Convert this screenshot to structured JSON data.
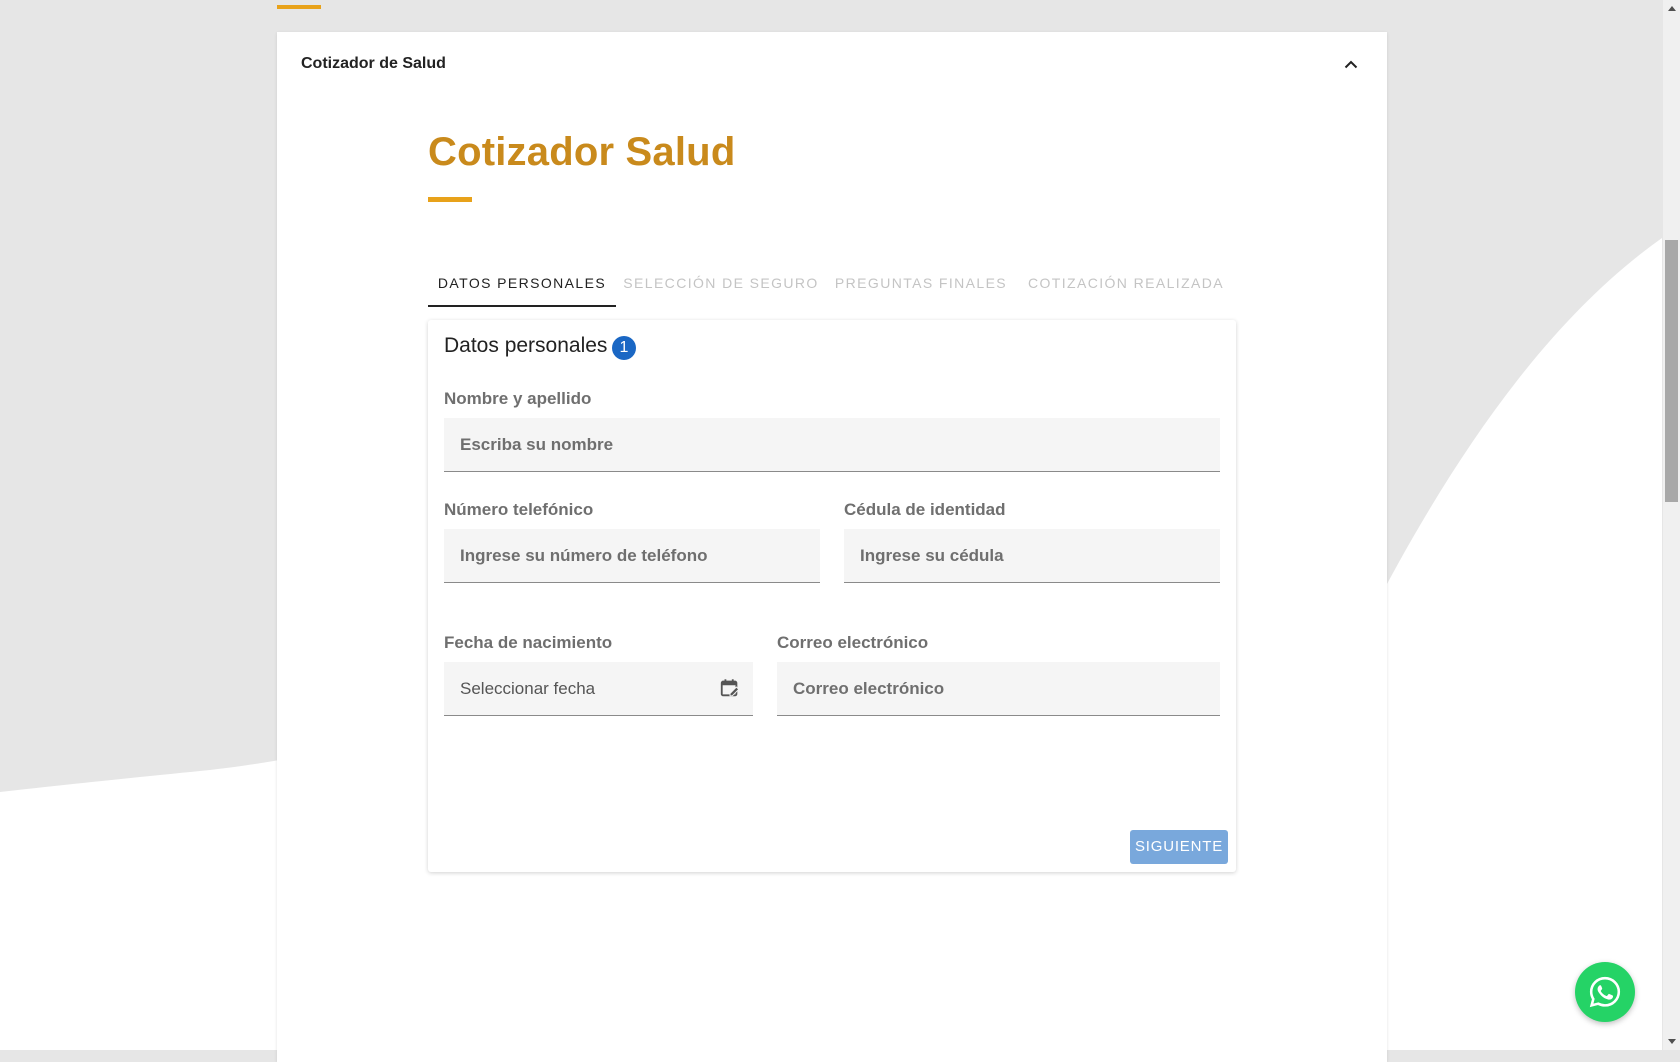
{
  "panel": {
    "header_title": "Cotizador de Salud"
  },
  "main": {
    "title": "Cotizador Salud"
  },
  "tabs": [
    {
      "label": "DATOS PERSONALES",
      "active": true
    },
    {
      "label": "SELECCIÓN DE SEGURO",
      "active": false
    },
    {
      "label": "PREGUNTAS FINALES",
      "active": false
    },
    {
      "label": "COTIZACIÓN REALIZADA",
      "active": false
    }
  ],
  "form": {
    "section_title": "Datos personales",
    "step_number": "1",
    "name": {
      "label": "Nombre y apellido",
      "placeholder": "Escriba su nombre",
      "value": ""
    },
    "phone": {
      "label": "Número telefónico",
      "placeholder": "Ingrese su número de teléfono",
      "value": ""
    },
    "id_card": {
      "label": "Cédula de identidad",
      "placeholder": "Ingrese su cédula",
      "value": ""
    },
    "birthdate": {
      "label": "Fecha de nacimiento",
      "display": "Seleccionar fecha"
    },
    "email": {
      "label": "Correo electrónico",
      "placeholder": "Correo electrónico",
      "value": ""
    },
    "next_label": "SIGUIENTE"
  },
  "icons": {
    "collapse": "chevron-up-icon",
    "calendar": "calendar-edit-icon",
    "chat": "whatsapp-icon"
  },
  "colors": {
    "accent": "#e8a21a",
    "title": "#c98a1c",
    "step_badge": "#1a67c4",
    "next_button": "#79a8dc",
    "whatsapp": "#25d366"
  }
}
